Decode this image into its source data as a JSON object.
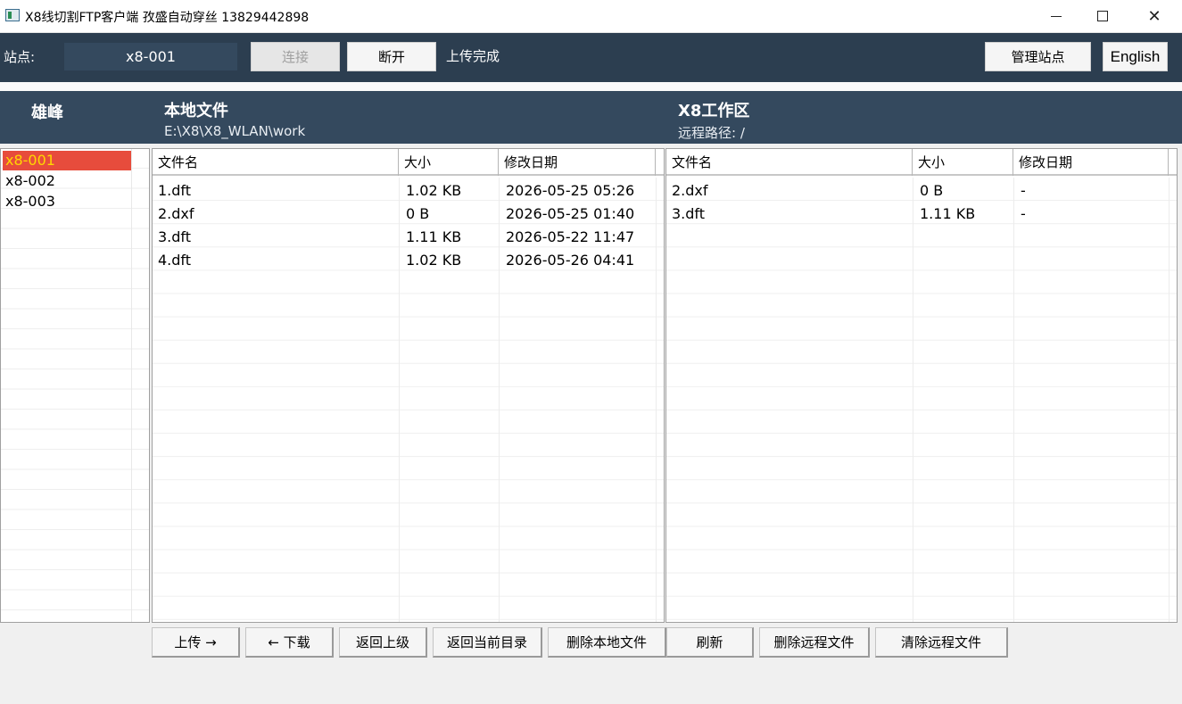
{
  "window": {
    "title": "X8线切割FTP客户端     孜盛自动穿丝 13829442898"
  },
  "toolbar": {
    "site_label": "站点:",
    "site_value": "x8-001",
    "connect_label": "连接",
    "disconnect_label": "断开",
    "status": "上传完成",
    "manage_label": "管理站点",
    "language_label": "English"
  },
  "header": {
    "brand": "雄峰",
    "local_title": "本地文件",
    "local_path": "E:\\X8\\X8_WLAN\\work",
    "remote_title": "X8工作区",
    "remote_path": "远程路径: /"
  },
  "stations": [
    "x8-001",
    "x8-002",
    "x8-003"
  ],
  "local_table": {
    "columns": [
      "文件名",
      "大小",
      "修改日期"
    ],
    "rows": [
      [
        "1.dft",
        "1.02 KB",
        "2026-05-25 05:26"
      ],
      [
        "2.dxf",
        "0 B",
        "2026-05-25 01:40"
      ],
      [
        "3.dft",
        "1.11 KB",
        "2026-05-22 11:47"
      ],
      [
        "4.dft",
        "1.02 KB",
        "2026-05-26 04:41"
      ]
    ]
  },
  "remote_table": {
    "columns": [
      "文件名",
      "大小",
      "修改日期"
    ],
    "rows": [
      [
        "2.dxf",
        "0 B",
        "-"
      ],
      [
        "3.dft",
        "1.11 KB",
        "-"
      ]
    ]
  },
  "actions": {
    "upload": "上传 →",
    "download": "← 下载",
    "go_up": "返回上级",
    "go_current": "返回当前目录",
    "delete_local": "删除本地文件",
    "refresh": "刷新",
    "delete_remote": "删除远程文件",
    "clear_remote": "清除远程文件"
  },
  "colors": {
    "toolbar_bg": "#2c3e50",
    "header_bg": "#34495e",
    "selected_bg": "#e74c3c",
    "selected_text": "#ffd700"
  }
}
